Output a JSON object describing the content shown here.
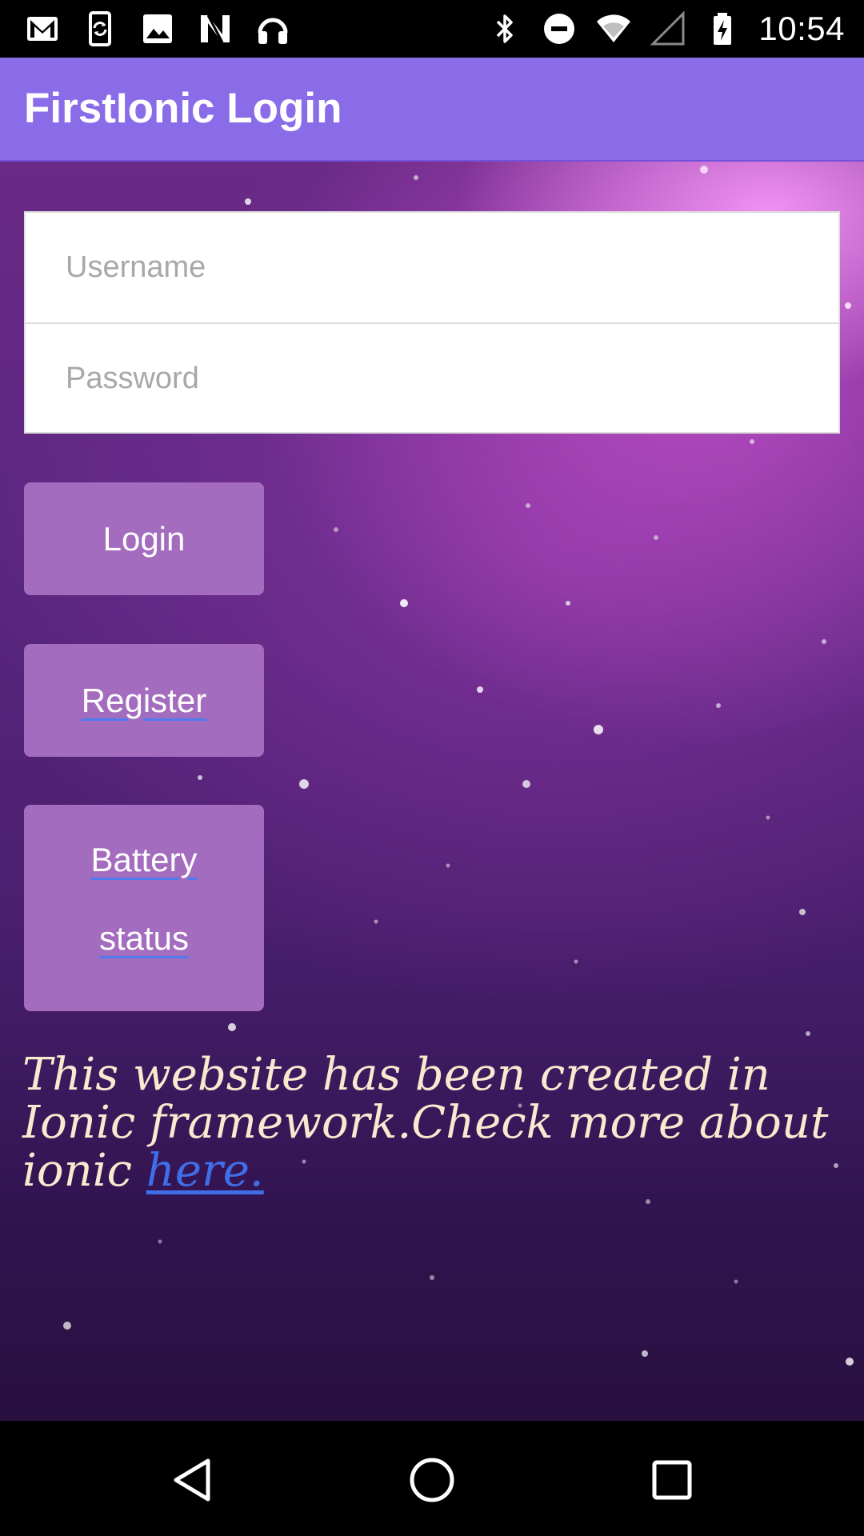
{
  "status_bar": {
    "clock": "10:54",
    "left_icons": [
      "gmail-icon",
      "phone-sync-icon",
      "image-icon",
      "n-logo-icon",
      "headphones-icon"
    ],
    "right_icons": [
      "bluetooth-icon",
      "do-not-disturb-icon",
      "wifi-icon",
      "cell-signal-icon",
      "battery-charging-icon"
    ]
  },
  "toolbar": {
    "title": "FirstIonic Login"
  },
  "login_form": {
    "username_placeholder": "Username",
    "username_value": "",
    "password_placeholder": "Password",
    "password_value": ""
  },
  "buttons": {
    "login": "Login",
    "register": "Register",
    "battery_line1": "Battery",
    "battery_line2": "status"
  },
  "footer": {
    "text": "This website has been created in Ionic framework.Check more about ionic ",
    "link_text": "here."
  },
  "nav_bar": {
    "icons": [
      "back-icon",
      "home-icon",
      "recents-icon"
    ]
  },
  "colors": {
    "toolbar": "#8a6ce8",
    "button": "#a36cbe",
    "footer_text": "#f8e9cf",
    "link": "#3f6fe8"
  }
}
